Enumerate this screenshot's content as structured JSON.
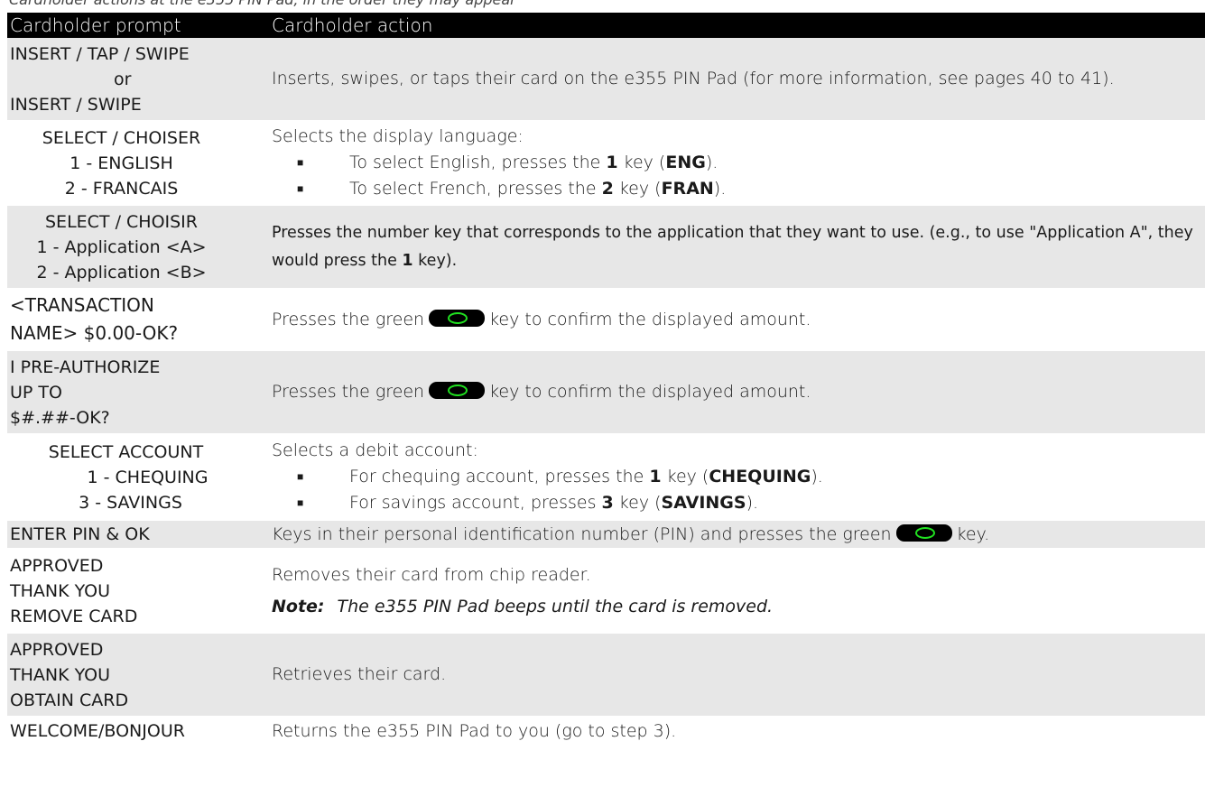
{
  "caption": "Cardholder actions at the e355 PIN Pad, in the order they may appear",
  "headers": {
    "prompt": "Cardholder prompt",
    "action": "Cardholder action"
  },
  "rows": [
    {
      "prompt": [
        "INSERT / TAP / SWIPE",
        "or",
        "INSERT / SWIPE"
      ],
      "action": "Inserts, swipes, or taps their card on the e355 PIN Pad (for more information, see pages 40 to 41)."
    },
    {
      "prompt": [
        "SELECT / CHOISER",
        "1 - ENGLISH",
        "2 - FRANCAIS"
      ],
      "action_intro": "Selects the display language:",
      "bullets": [
        {
          "pre": "To select English, presses the ",
          "key": "1",
          "mid": " key (",
          "code": "ENG",
          "post": ")."
        },
        {
          "pre": "To select French, presses the ",
          "key": "2",
          "mid": " key (",
          "code": "FRAN",
          "post": ")."
        }
      ]
    },
    {
      "prompt": [
        "SELECT / CHOISIR",
        "1 - Application <A>",
        "2 - Application <B>"
      ],
      "action_pre": "Presses the number key that corresponds to the application that they want to use. (e.g., to use \"Application A\", they would press the ",
      "action_key": "1",
      "action_post": " key)."
    },
    {
      "prompt": [
        "<TRANSACTION",
        "NAME> $0.00-OK?"
      ],
      "action_pre": "Presses the green",
      "action_post": "key to confirm the displayed amount."
    },
    {
      "prompt": [
        "I PRE-AUTHORIZE",
        "UP TO",
        "$#.##-OK?"
      ],
      "action_pre": "Presses the green",
      "action_post": "key to confirm the displayed amount."
    },
    {
      "prompt": [
        "SELECT ACCOUNT",
        "1 - CHEQUING",
        "3 - SAVINGS"
      ],
      "action_intro": "Selects a debit account:",
      "bullets": [
        {
          "pre": "For chequing account, presses the ",
          "key": "1",
          "mid": " key (",
          "code": "CHEQUING",
          "post": ")."
        },
        {
          "pre": "For savings account, presses ",
          "key": "3",
          "mid": " key (",
          "code": "SAVINGS",
          "post": ")."
        }
      ]
    },
    {
      "prompt": [
        "ENTER PIN & OK"
      ],
      "action_pre": "Keys in their personal identification number (PIN) and presses the green",
      "action_post": "key."
    },
    {
      "prompt": [
        "APPROVED",
        "THANK YOU",
        "REMOVE CARD"
      ],
      "action": "Removes their card from chip reader.",
      "note_label": "Note:",
      "note_text": "The e355 PIN Pad beeps until the card is removed."
    },
    {
      "prompt": [
        "APPROVED",
        "THANK YOU",
        "OBTAIN CARD"
      ],
      "action": "Retrieves their card."
    },
    {
      "prompt": [
        "WELCOME/BONJOUR"
      ],
      "action": "Returns the e355 PIN Pad to you (go to step 3)."
    }
  ],
  "icons": {
    "ok_key": "green-ok-key-icon",
    "bullet": "square-bullet-icon"
  },
  "colors": {
    "header_bg": "#000000",
    "shade_bg": "#e7e7e7",
    "ok_ring": "#20e020"
  }
}
